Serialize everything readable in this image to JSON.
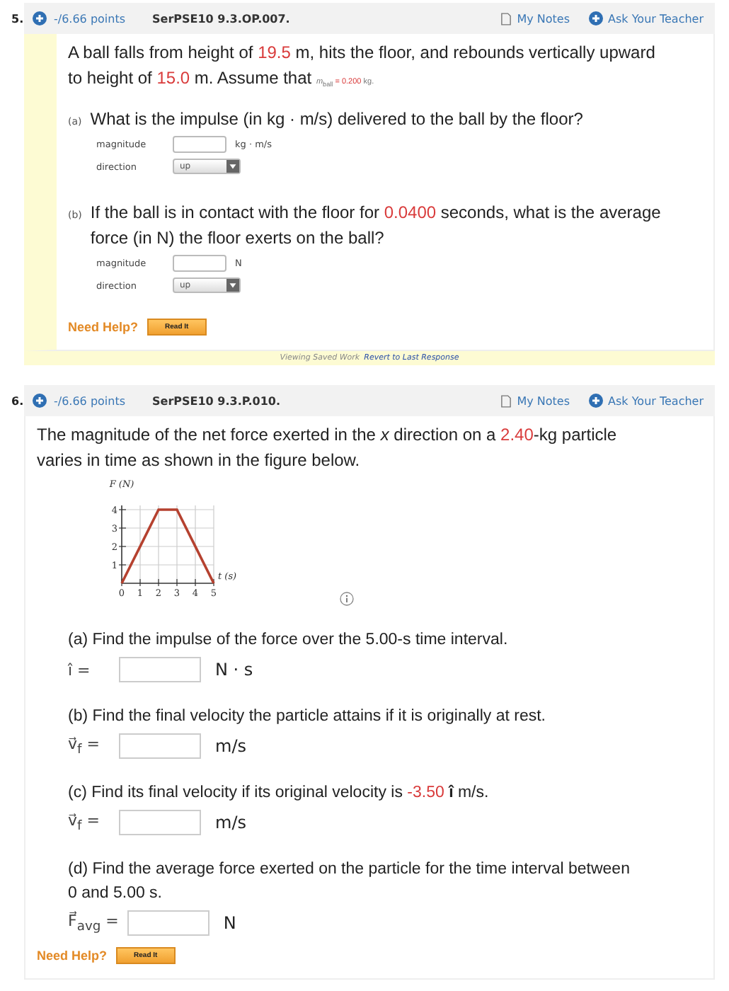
{
  "questions": [
    {
      "number": "5.",
      "points": "-/6.66 points",
      "code": "SerPSE10 9.3.OP.007.",
      "notes": "My Notes",
      "ask": "Ask Your Teacher",
      "intro": [
        {
          "kind": "plain",
          "text": "A ball falls from height of "
        },
        {
          "kind": "value",
          "text": "19.5"
        },
        {
          "kind": "plain",
          "text": " m, hits the floor, and rebounds vertically upward to height of "
        },
        {
          "kind": "value",
          "text": "15.0"
        },
        {
          "kind": "plain",
          "text": " m. Assume that "
        },
        {
          "kind": "small",
          "text": "*m*$_{ball}$"
        },
        {
          "kind": "small-value",
          "text": " = 0.200"
        },
        {
          "kind": "small",
          "text": " kg."
        }
      ],
      "parts": [
        {
          "label": "(a)",
          "text": [
            {
              "kind": "plain",
              "text": "What is the impulse (in kg · m/s) delivered to the ball by the floor?"
            }
          ],
          "fields": [
            {
              "kind": "input",
              "label": "magnitude",
              "unit": "kg · m/s"
            },
            {
              "kind": "select",
              "label": "direction",
              "value": "up"
            }
          ]
        },
        {
          "label": "(b)",
          "text": [
            {
              "kind": "plain",
              "text": "If the ball is in contact with the floor for "
            },
            {
              "kind": "value",
              "text": "0.0400"
            },
            {
              "kind": "plain",
              "text": " seconds, what is the average force (in N) the floor exerts on the ball?"
            }
          ],
          "fields": [
            {
              "kind": "input",
              "label": "magnitude",
              "unit": "N"
            },
            {
              "kind": "select",
              "label": "direction",
              "value": "up"
            }
          ]
        }
      ],
      "help": {
        "label": "Need Help?",
        "button": "Read It"
      },
      "footer": {
        "text": "Viewing Saved Work",
        "link": "Revert to Last Response"
      }
    },
    {
      "number": "6.",
      "points": "-/6.66 points",
      "code": "SerPSE10 9.3.P.010.",
      "notes": "My Notes",
      "ask": "Ask Your Teacher",
      "intro": [
        {
          "kind": "plain",
          "text": "The magnitude of the net force exerted in the *x* direction on a "
        },
        {
          "kind": "value",
          "text": "2.40"
        },
        {
          "kind": "plain",
          "text": "-kg particle varies in time as shown in the figure below."
        }
      ],
      "figure": {
        "chart_data": {
          "type": "line",
          "xlabel": "t (s)",
          "ylabel": "F (N)",
          "x": [
            0,
            2,
            3,
            5
          ],
          "series": [
            {
              "color": "#b5412f",
              "values": [
                0,
                4,
                4,
                0
              ]
            }
          ],
          "xlim": [
            0,
            5
          ],
          "ylim": [
            0,
            4
          ],
          "grid": true,
          "xticks": [
            0,
            1,
            2,
            3,
            4,
            5
          ],
          "yticks": [
            1,
            2,
            3,
            4
          ]
        }
      },
      "parts": [
        {
          "text": [
            {
              "kind": "plain",
              "text": "(a) Find the impulse of the force over the 5.00-s time interval."
            }
          ],
          "fields": [
            {
              "kind": "equation",
              "symbol": "î =",
              "unit": "N · s"
            }
          ]
        },
        {
          "text": [
            {
              "kind": "plain",
              "text": "(b) Find the final velocity the particle attains if it is originally at rest."
            }
          ],
          "fields": [
            {
              "kind": "equation",
              "symbol": "v⃗$_{f}$ =",
              "unit": "m/s"
            }
          ]
        },
        {
          "text": [
            {
              "kind": "plain",
              "text": "(c) Find its final velocity if its original velocity is "
            },
            {
              "kind": "value",
              "text": "-3.50"
            },
            {
              "kind": "plain",
              "text": " **î** m/s."
            }
          ],
          "fields": [
            {
              "kind": "equation",
              "symbol": "v⃗$_{f}$ =",
              "unit": "m/s"
            }
          ]
        },
        {
          "text": [
            {
              "kind": "plain",
              "text": "(d) Find the average force exerted on the particle for the time interval between 0 and 5.00 s."
            }
          ],
          "fields": [
            {
              "kind": "equation",
              "symbol": "F⃗$_{avg}$ =",
              "unit": "N"
            }
          ]
        }
      ],
      "help": {
        "label": "Need Help?",
        "button": "Read It"
      }
    }
  ]
}
